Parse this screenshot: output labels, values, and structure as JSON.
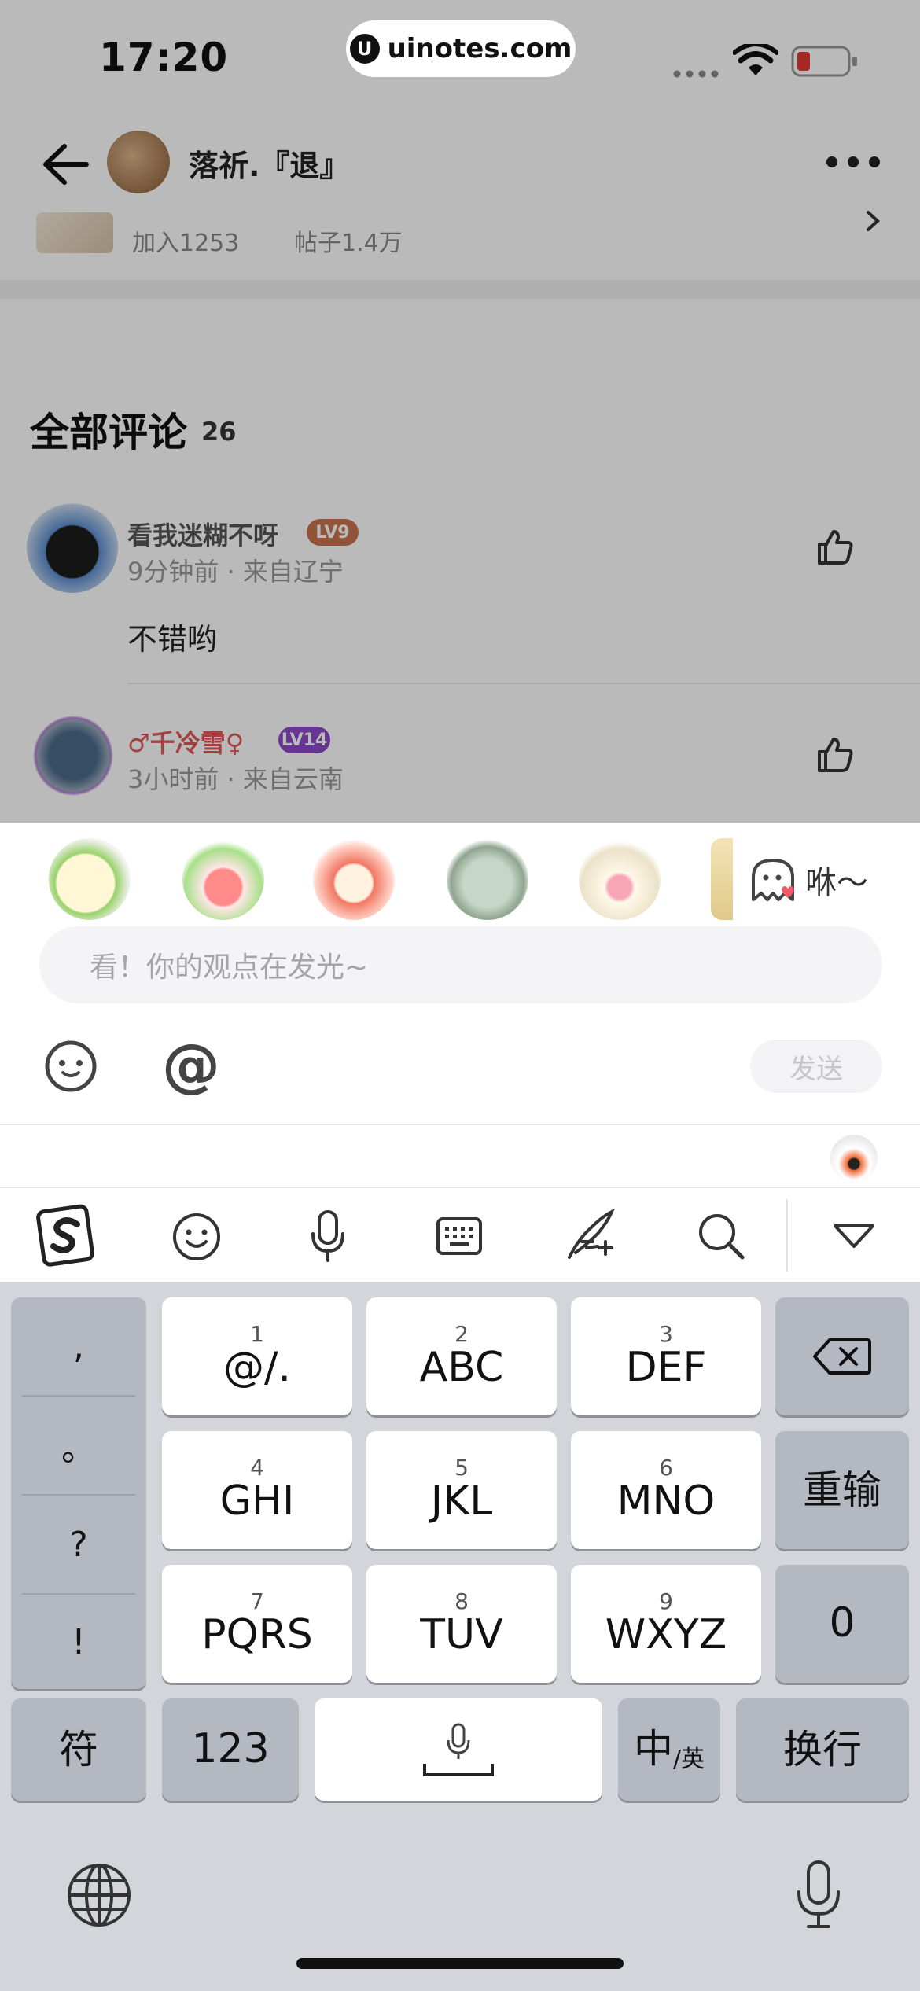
{
  "status_bar": {
    "time": "17:20",
    "url": "uinotes.com",
    "url_logo": "U"
  },
  "header": {
    "username": "落祈.『退』",
    "back_icon": "back-arrow-icon",
    "more_icon": "more-dots-icon"
  },
  "forum": {
    "joined": "加入1253",
    "posts": "帖子1.4万"
  },
  "comments": {
    "title": "全部评论",
    "count": "26",
    "items": [
      {
        "name": "看我迷糊不呀",
        "level": "LV9",
        "meta": "9分钟前 · 来自辽宁",
        "body": "不错哟",
        "level_color": "#c8744d"
      },
      {
        "name": "♂千冷雪♀",
        "level": "LV14",
        "meta": "3小时前 · 来自云南",
        "body": "",
        "level_color": "#8d4ac6"
      }
    ]
  },
  "sticker_bar": {
    "label": "咻～"
  },
  "composer": {
    "placeholder": "看！你的观点在发光~",
    "send_label": "发送",
    "at_label": "@"
  },
  "keyboard": {
    "toolbar_icons": [
      "sogou-logo-icon",
      "emoji-icon",
      "microphone-icon",
      "keyboard-icon",
      "handwriting-icon",
      "search-icon",
      "collapse-keyboard-icon"
    ],
    "punctuation": [
      ",",
      "。",
      "?",
      "!"
    ],
    "keys": [
      {
        "num": "1",
        "label": "@/."
      },
      {
        "num": "2",
        "label": "ABC"
      },
      {
        "num": "3",
        "label": "DEF"
      },
      {
        "num": "4",
        "label": "GHI"
      },
      {
        "num": "5",
        "label": "JKL"
      },
      {
        "num": "6",
        "label": "MNO"
      },
      {
        "num": "7",
        "label": "PQRS"
      },
      {
        "num": "8",
        "label": "TUV"
      },
      {
        "num": "9",
        "label": "WXYZ"
      }
    ],
    "reenter_label": "重输",
    "zero_label": "0",
    "symbols_label": "符",
    "numbers_label": "123",
    "lang_main": "中",
    "lang_sub": "/英",
    "newline_label": "换行"
  }
}
